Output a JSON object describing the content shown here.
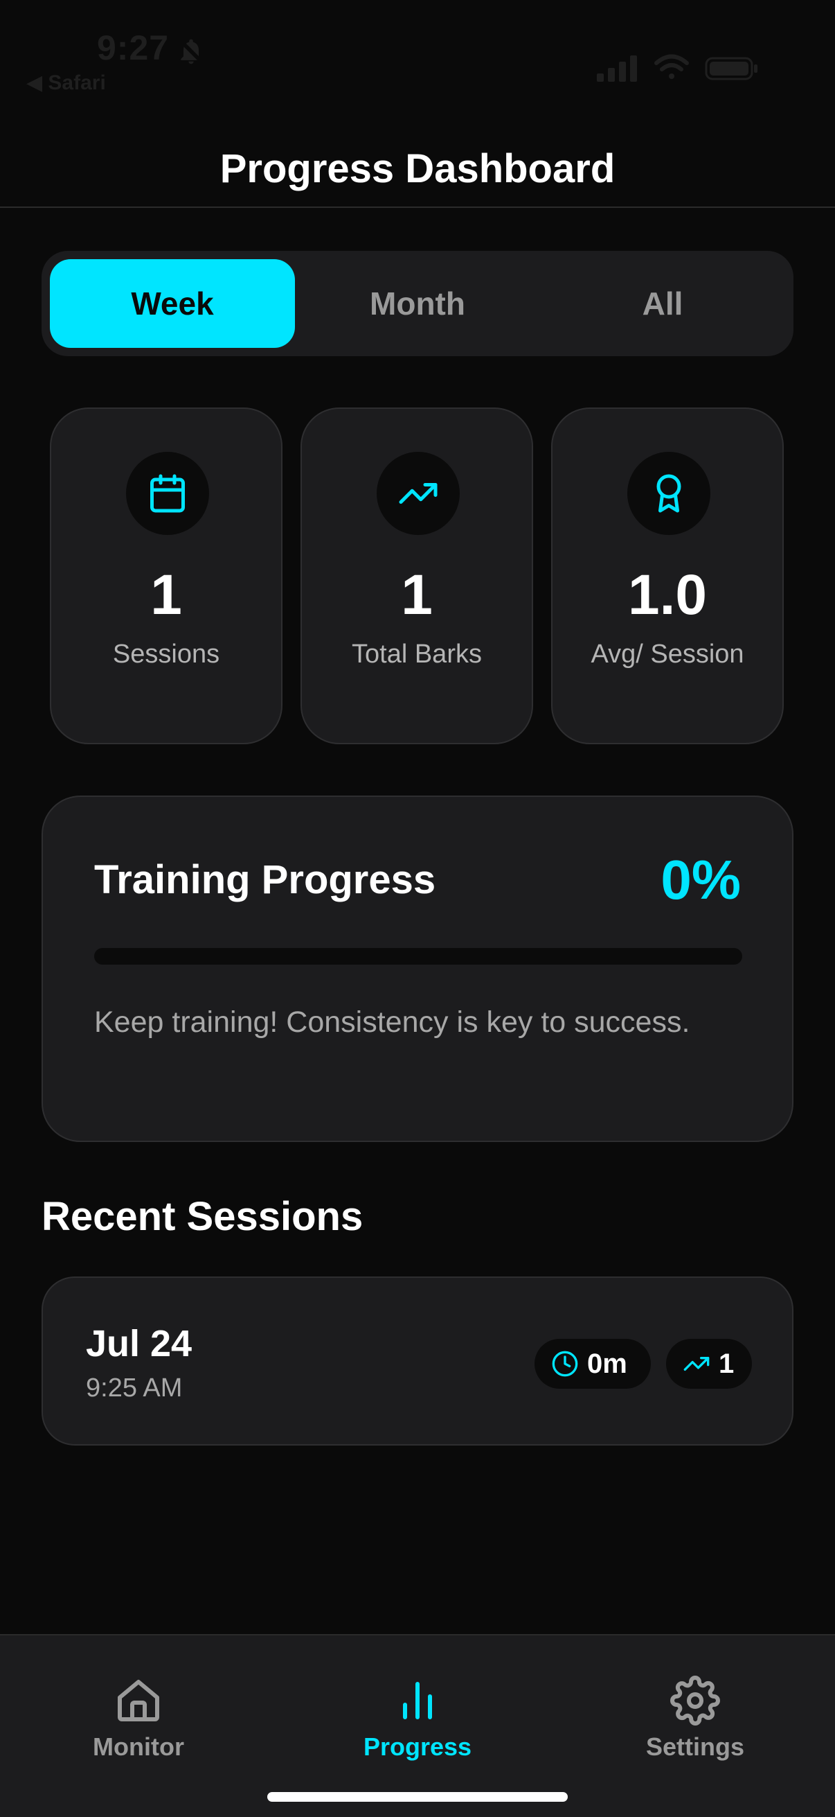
{
  "status_bar": {
    "time": "9:27",
    "back_label": "◀ Safari"
  },
  "header": {
    "title": "Progress Dashboard"
  },
  "segments": {
    "items": [
      "Week",
      "Month",
      "All"
    ],
    "selected": "Week"
  },
  "stats": [
    {
      "icon": "calendar-icon",
      "value": "1",
      "label": "Sessions"
    },
    {
      "icon": "trending-up-icon",
      "value": "1",
      "label": "Total Barks"
    },
    {
      "icon": "award-icon",
      "value": "1.0",
      "label": "Avg/ Session"
    }
  ],
  "training_progress": {
    "title": "Training Progress",
    "percent_label": "0%",
    "percent_value": 0,
    "message": "Keep training! Consistency is key to success."
  },
  "recent_sessions": {
    "title": "Recent Sessions",
    "items": [
      {
        "date": "Jul 24",
        "time": "9:25 AM",
        "duration": "0m",
        "barks": "1",
        "duration_icon": "clock-icon",
        "barks_icon": "trending-up-icon"
      }
    ]
  },
  "tab_bar": {
    "items": [
      {
        "label": "Monitor",
        "icon": "home-icon"
      },
      {
        "label": "Progress",
        "icon": "bar-chart-icon"
      },
      {
        "label": "Settings",
        "icon": "gear-icon"
      }
    ],
    "active": "Progress"
  },
  "colors": {
    "accent": "#00e5ff",
    "background": "#0a0a0a",
    "card": "#1c1c1e",
    "muted_text": "#a8a8a8"
  }
}
